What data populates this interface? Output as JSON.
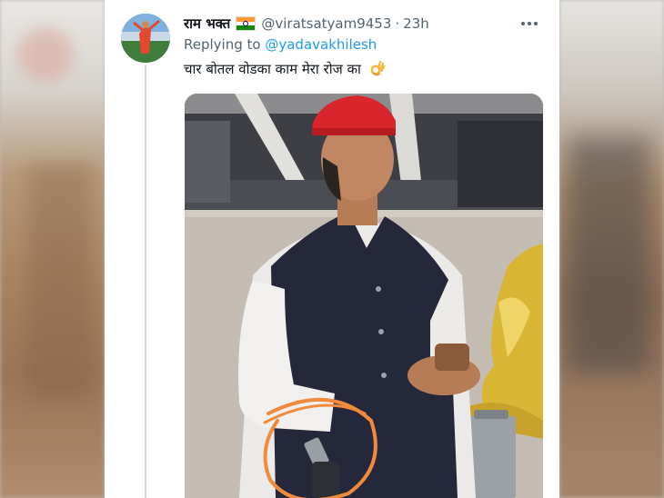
{
  "tweet": {
    "display_name": "राम भक्त",
    "flag_icon": "india-flag-icon",
    "handle": "@viratsatyam9453",
    "separator": "·",
    "time": "23h",
    "more_icon": "more-options-icon",
    "replying_prefix": "Replying to",
    "replying_to": "@yadavakhilesh",
    "text": "चार बोतल वोडका काम मेरा रोज का",
    "emoji": "ok-hand-icon"
  },
  "colors": {
    "link": "#1d9bf0",
    "secondary_text": "#536471",
    "primary_text": "#0f1419",
    "annotation_circle": "#f08a3c",
    "cap": "#d8262c"
  }
}
